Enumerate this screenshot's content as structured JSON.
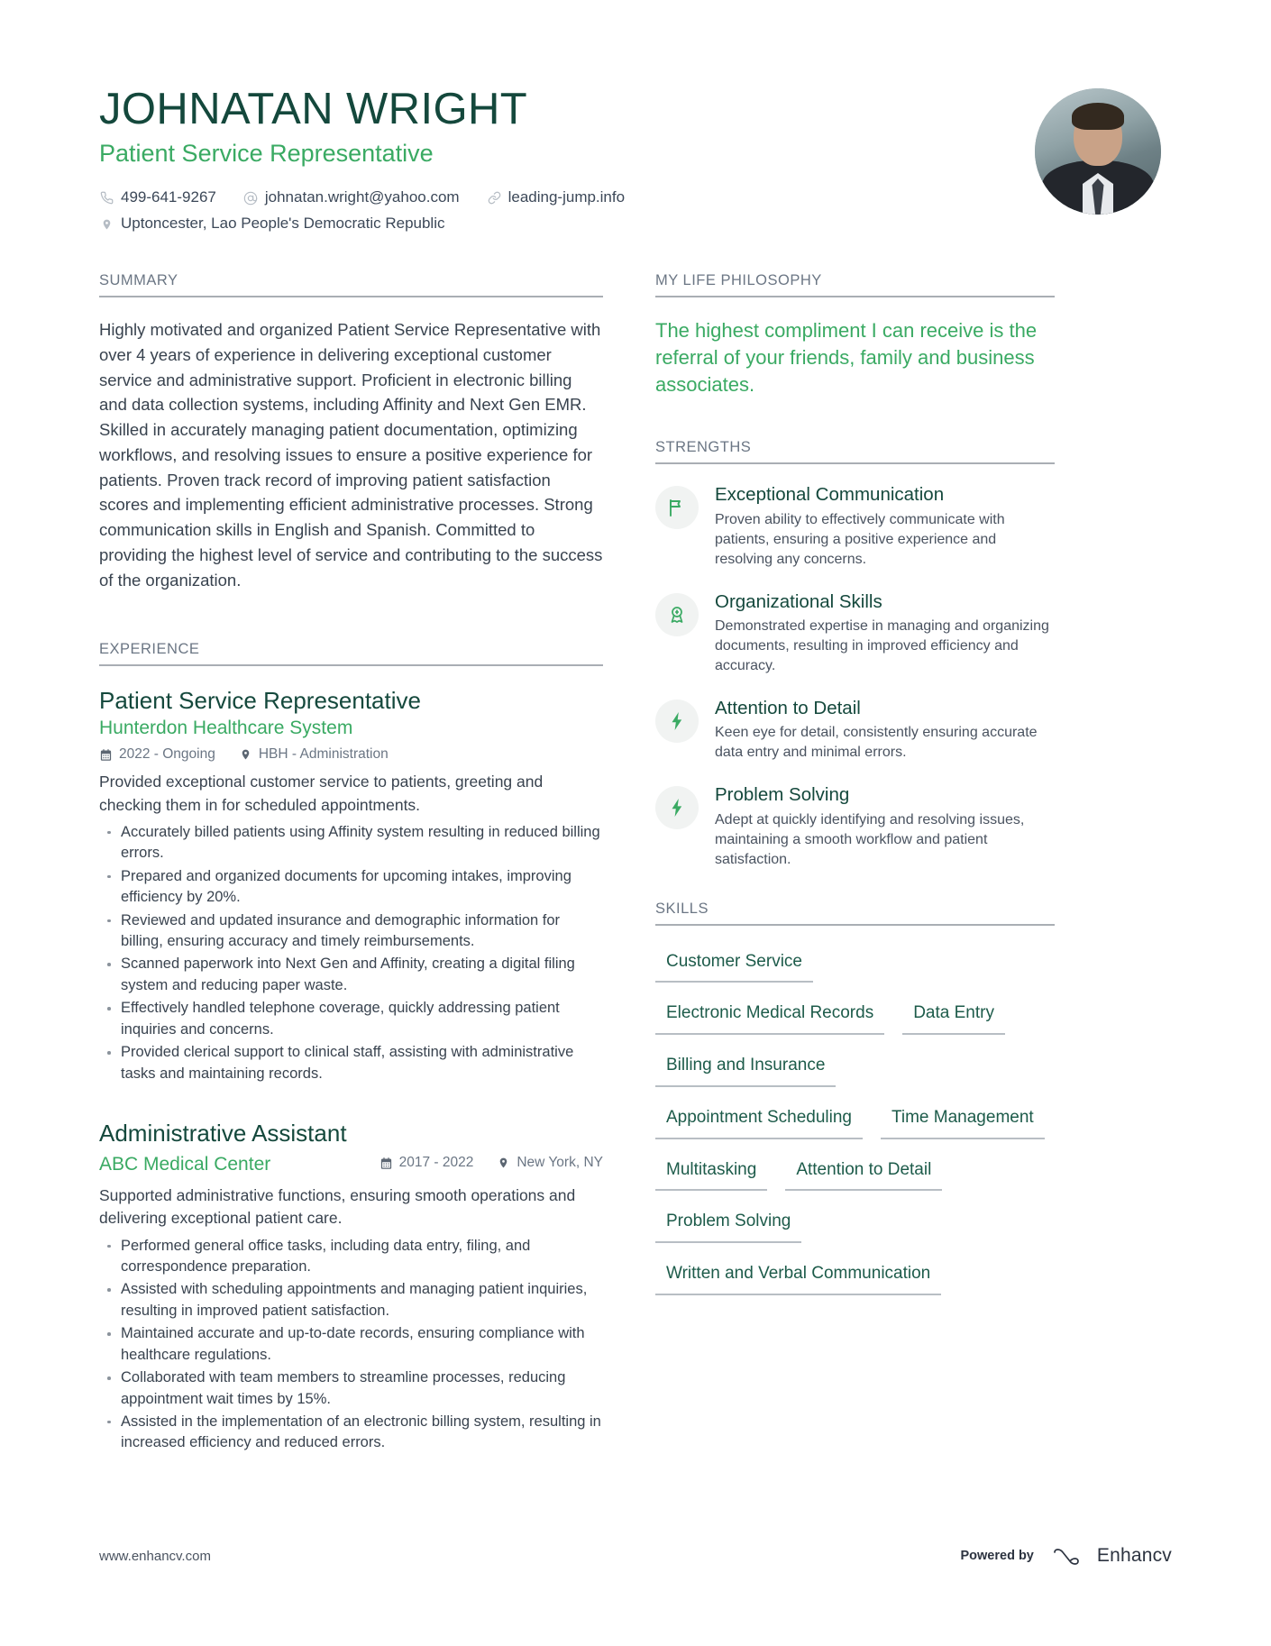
{
  "header": {
    "full_name": "JOHNATAN WRIGHT",
    "job_title": "Patient Service Representative",
    "contacts": [
      {
        "icon": "phone-icon",
        "value": "499-641-9267"
      },
      {
        "icon": "email-icon",
        "value": "johnatan.wright@yahoo.com"
      },
      {
        "icon": "link-icon",
        "value": "leading-jump.info"
      }
    ],
    "location": {
      "icon": "location-icon",
      "value": "Uptoncester, Lao People's Democratic Republic"
    },
    "avatar_alt": "profile-photo"
  },
  "summary": {
    "heading": "SUMMARY",
    "text": "Highly motivated and organized Patient Service Representative with over 4 years of experience in delivering exceptional customer service and administrative support. Proficient in electronic billing and data collection systems, including Affinity and Next Gen EMR. Skilled in accurately managing patient documentation, optimizing workflows, and resolving issues to ensure a positive experience for patients. Proven track record of improving patient satisfaction scores and implementing efficient administrative processes. Strong communication skills in English and Spanish. Committed to providing the highest level of service and contributing to the success of the organization."
  },
  "experience": {
    "heading": "EXPERIENCE",
    "jobs": [
      {
        "title": "Patient Service Representative",
        "company": "Hunterdon Healthcare System",
        "dates": "2022 - Ongoing",
        "location": "HBH - Administration",
        "layout": "stacked",
        "lead": "Provided exceptional customer service to patients, greeting and checking them in for scheduled appointments.",
        "bullets": [
          "Accurately billed patients using Affinity system resulting in reduced billing errors.",
          "Prepared and organized documents for upcoming intakes, improving efficiency by 20%.",
          "Reviewed and updated insurance and demographic information for billing, ensuring accuracy and timely reimbursements.",
          "Scanned paperwork into Next Gen and Affinity, creating a digital filing system and reducing paper waste.",
          "Effectively handled telephone coverage, quickly addressing patient inquiries and concerns.",
          "Provided clerical support to clinical staff, assisting with administrative tasks and maintaining records."
        ]
      },
      {
        "title": "Administrative Assistant",
        "company": "ABC Medical Center",
        "dates": "2017 - 2022",
        "location": "New York, NY",
        "layout": "inline",
        "lead": "Supported administrative functions, ensuring smooth operations and delivering exceptional patient care.",
        "bullets": [
          "Performed general office tasks, including data entry, filing, and correspondence preparation.",
          "Assisted with scheduling appointments and managing patient inquiries, resulting in improved patient satisfaction.",
          "Maintained accurate and up-to-date records, ensuring compliance with healthcare regulations.",
          "Collaborated with team members to streamline processes, reducing appointment wait times by 15%.",
          "Assisted in the implementation of an electronic billing system, resulting in increased efficiency and reduced errors."
        ]
      }
    ]
  },
  "philosophy": {
    "heading": "MY LIFE PHILOSOPHY",
    "quote": "The highest compliment I can receive is the referral of your friends, family and business associates."
  },
  "strengths": {
    "heading": "STRENGTHS",
    "items": [
      {
        "icon": "flag-icon",
        "name": "Exceptional Communication",
        "description": "Proven ability to effectively communicate with patients, ensuring a positive experience and resolving any concerns."
      },
      {
        "icon": "award-icon",
        "name": "Organizational Skills",
        "description": "Demonstrated expertise in managing and organizing documents, resulting in improved efficiency and accuracy."
      },
      {
        "icon": "bolt-icon",
        "name": "Attention to Detail",
        "description": "Keen eye for detail, consistently ensuring accurate data entry and minimal errors."
      },
      {
        "icon": "bolt-icon",
        "name": "Problem Solving",
        "description": "Adept at quickly identifying and resolving issues, maintaining a smooth workflow and patient satisfaction."
      }
    ]
  },
  "skills": {
    "heading": "SKILLS",
    "items": [
      "Customer Service",
      "Electronic Medical Records",
      "Data Entry",
      "Billing and Insurance",
      "Appointment Scheduling",
      "Time Management",
      "Multitasking",
      "Attention to Detail",
      "Problem Solving",
      "Written and Verbal Communication"
    ]
  },
  "footer": {
    "url": "www.enhancv.com",
    "powered_by": "Powered by",
    "brand": "Enhancv"
  },
  "colors": {
    "dark_green": "#14483c",
    "accent_green": "#3aaa63",
    "muted_heading": "#6b7684",
    "body_text": "#39434f",
    "rule": "#a9aeb4"
  }
}
